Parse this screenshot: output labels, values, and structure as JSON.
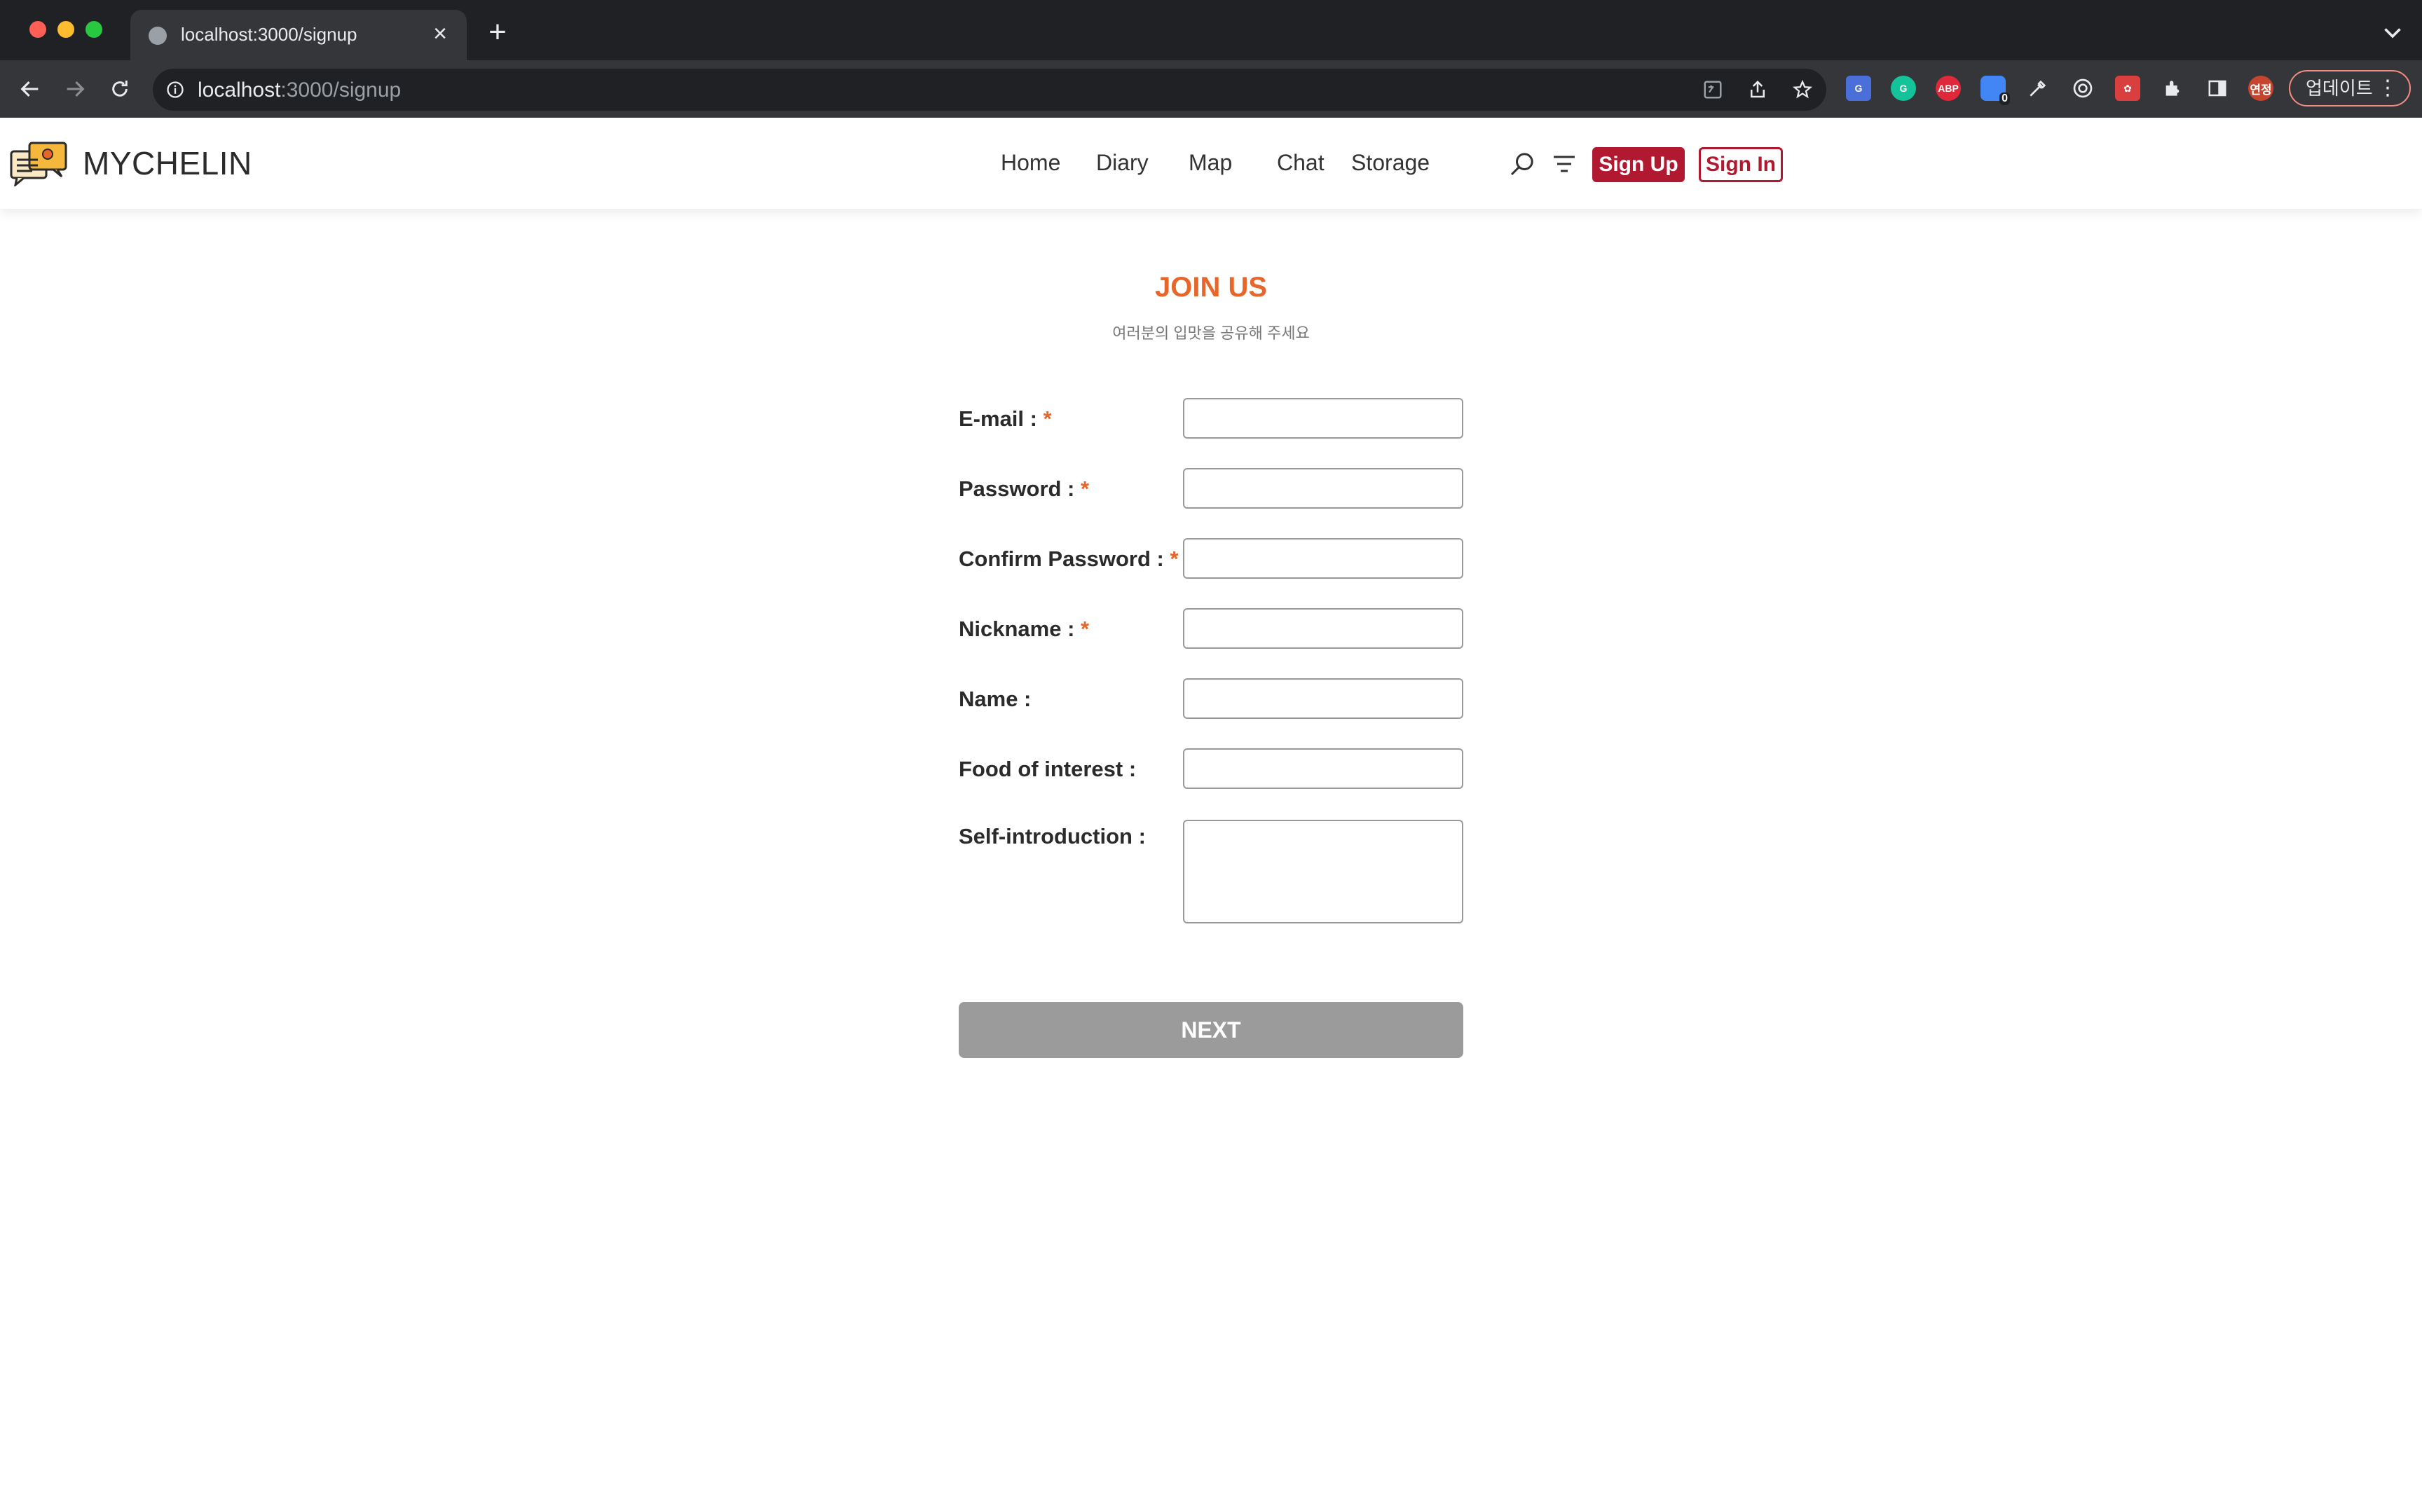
{
  "browser": {
    "tab_title": "localhost:3000/signup",
    "url_host": "localhost",
    "url_path": ":3000/signup",
    "update_label": "업데이트",
    "profile_label": "연정",
    "adblock_label": "ABP",
    "badge_count": "0"
  },
  "site": {
    "logo_text": "MYCHELIN",
    "nav": [
      "Home",
      "Diary",
      "Map",
      "Chat",
      "Storage"
    ],
    "signup_label": "Sign Up",
    "signin_label": "Sign In",
    "brand_color": "#b0192f",
    "accent_color": "#e8662a"
  },
  "form": {
    "title": "JOIN US",
    "subtitle": "여러분의 입맛을 공유해 주세요",
    "required_mark": "*",
    "fields": [
      {
        "label": "E-mail :",
        "required": true
      },
      {
        "label": "Password :",
        "required": true
      },
      {
        "label": "Confirm Password :",
        "required": true
      },
      {
        "label": "Nickname :",
        "required": true
      },
      {
        "label": "Name :",
        "required": false
      },
      {
        "label": "Food of interest :",
        "required": false
      },
      {
        "label": "Self-introduction :",
        "required": false
      }
    ],
    "next_label": "NEXT"
  }
}
